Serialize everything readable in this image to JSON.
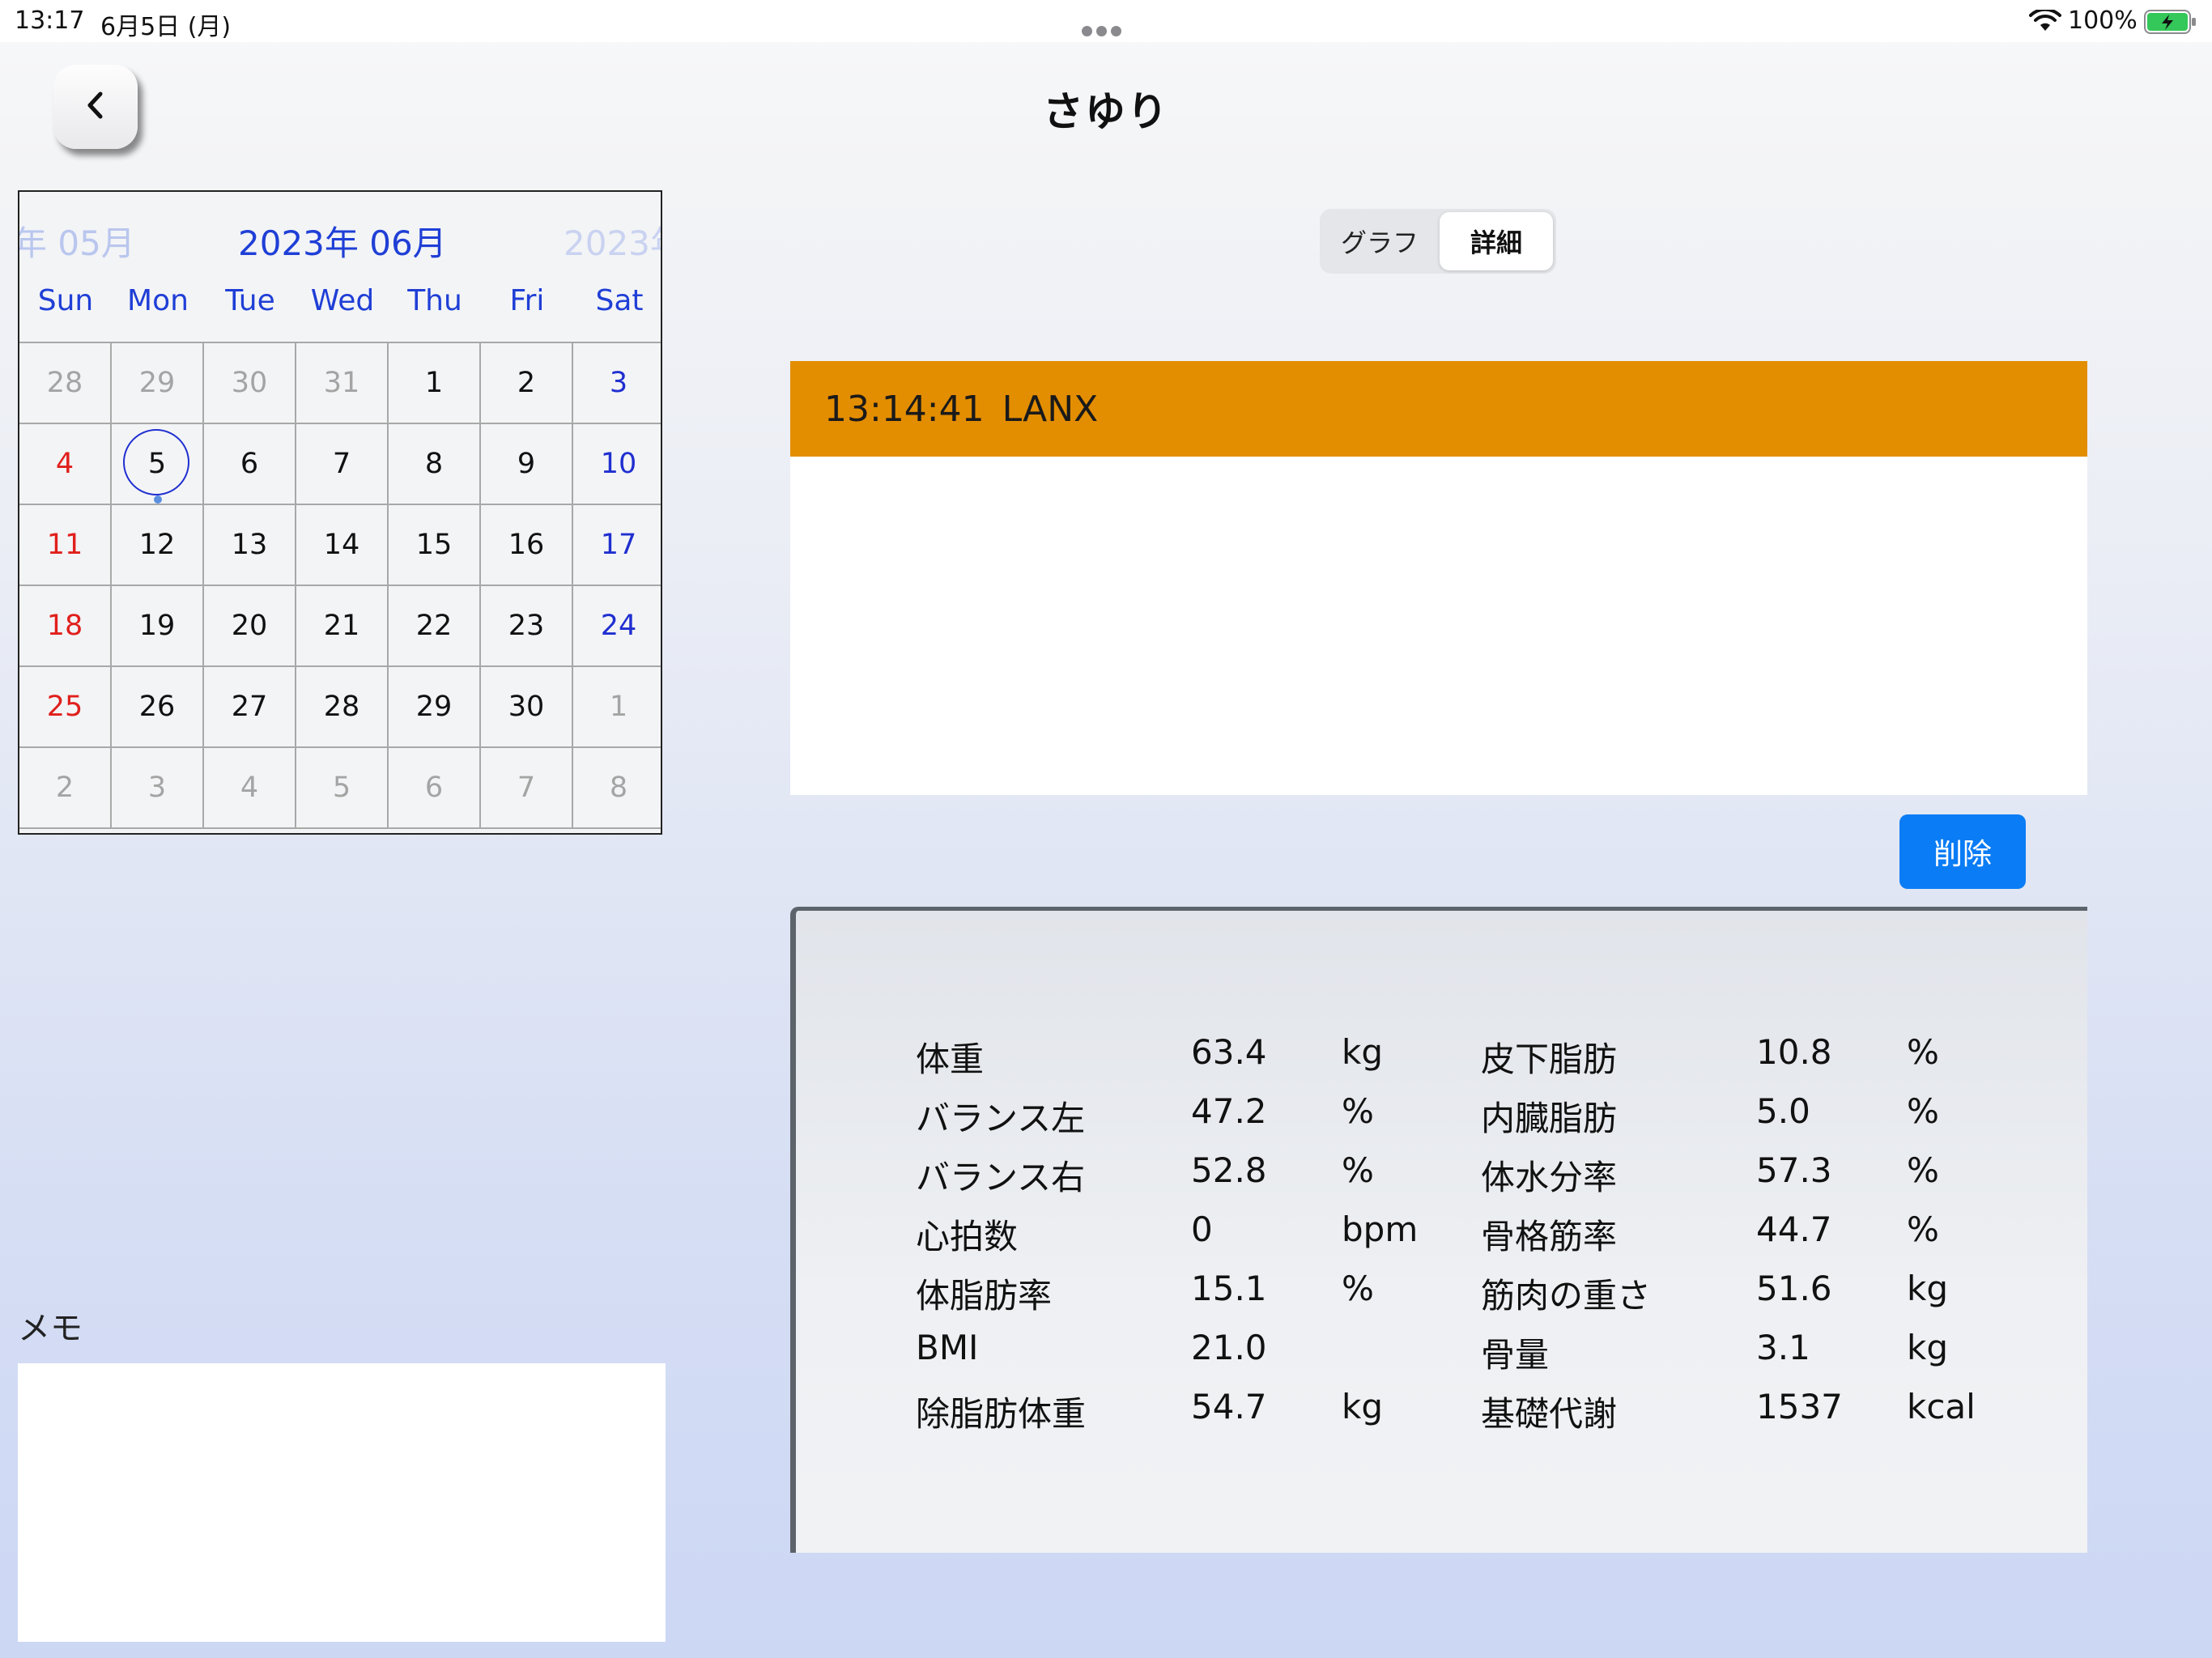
{
  "status_bar": {
    "time": "13:17",
    "date": "6月5日 (月)",
    "battery": "100%"
  },
  "nav": {
    "title": "さゆり"
  },
  "calendar": {
    "prev_month": "年 05月",
    "current_month": "2023年 06月",
    "next_month": "2023年",
    "weekdays": [
      "Sun",
      "Mon",
      "Tue",
      "Wed",
      "Thu",
      "Fri",
      "Sat"
    ],
    "days": [
      [
        "28",
        "29",
        "30",
        "31",
        "1",
        "2",
        "3"
      ],
      [
        "4",
        "5",
        "6",
        "7",
        "8",
        "9",
        "10"
      ],
      [
        "11",
        "12",
        "13",
        "14",
        "15",
        "16",
        "17"
      ],
      [
        "18",
        "19",
        "20",
        "21",
        "22",
        "23",
        "24"
      ],
      [
        "25",
        "26",
        "27",
        "28",
        "29",
        "30",
        "1"
      ],
      [
        "2",
        "3",
        "4",
        "5",
        "6",
        "7",
        "8"
      ]
    ],
    "selected_day": "5"
  },
  "tabs": {
    "graph": "グラフ",
    "detail": "詳細",
    "active": "詳細"
  },
  "record": {
    "time": "13:14:41",
    "device": "LANX"
  },
  "actions": {
    "delete": "削除"
  },
  "memo": {
    "label": "メモ",
    "value": ""
  },
  "metrics": [
    {
      "l_name": "体重",
      "l_value": "63.4",
      "l_unit": "kg",
      "r_name": "皮下脂肪",
      "r_value": "10.8",
      "r_unit": "%"
    },
    {
      "l_name": "バランス左",
      "l_value": "47.2",
      "l_unit": "%",
      "r_name": "内臓脂肪",
      "r_value": "5.0",
      "r_unit": "%"
    },
    {
      "l_name": "バランス右",
      "l_value": "52.8",
      "l_unit": "%",
      "r_name": "体水分率",
      "r_value": "57.3",
      "r_unit": "%"
    },
    {
      "l_name": "心拍数",
      "l_value": "0",
      "l_unit": "bpm",
      "r_name": "骨格筋率",
      "r_value": "44.7",
      "r_unit": "%"
    },
    {
      "l_name": "体脂肪率",
      "l_value": "15.1",
      "l_unit": "%",
      "r_name": "筋肉の重さ",
      "r_value": "51.6",
      "r_unit": "kg"
    },
    {
      "l_name": "BMI",
      "l_value": "21.0",
      "l_unit": "",
      "r_name": "骨量",
      "r_value": "3.1",
      "r_unit": "kg"
    },
    {
      "l_name": "除脂肪体重",
      "l_value": "54.7",
      "l_unit": "kg",
      "r_name": "基礎代謝",
      "r_value": "1537",
      "r_unit": "kcal"
    }
  ],
  "colors": {
    "accent_blue": "#0a7cf5",
    "record_header": "#e38d00",
    "sunday_red": "#e0201c",
    "saturday_blue": "#1f2fd0"
  },
  "icons": {
    "back": "chevron-left-icon",
    "wifi": "wifi-icon",
    "battery": "battery-charging-icon"
  }
}
